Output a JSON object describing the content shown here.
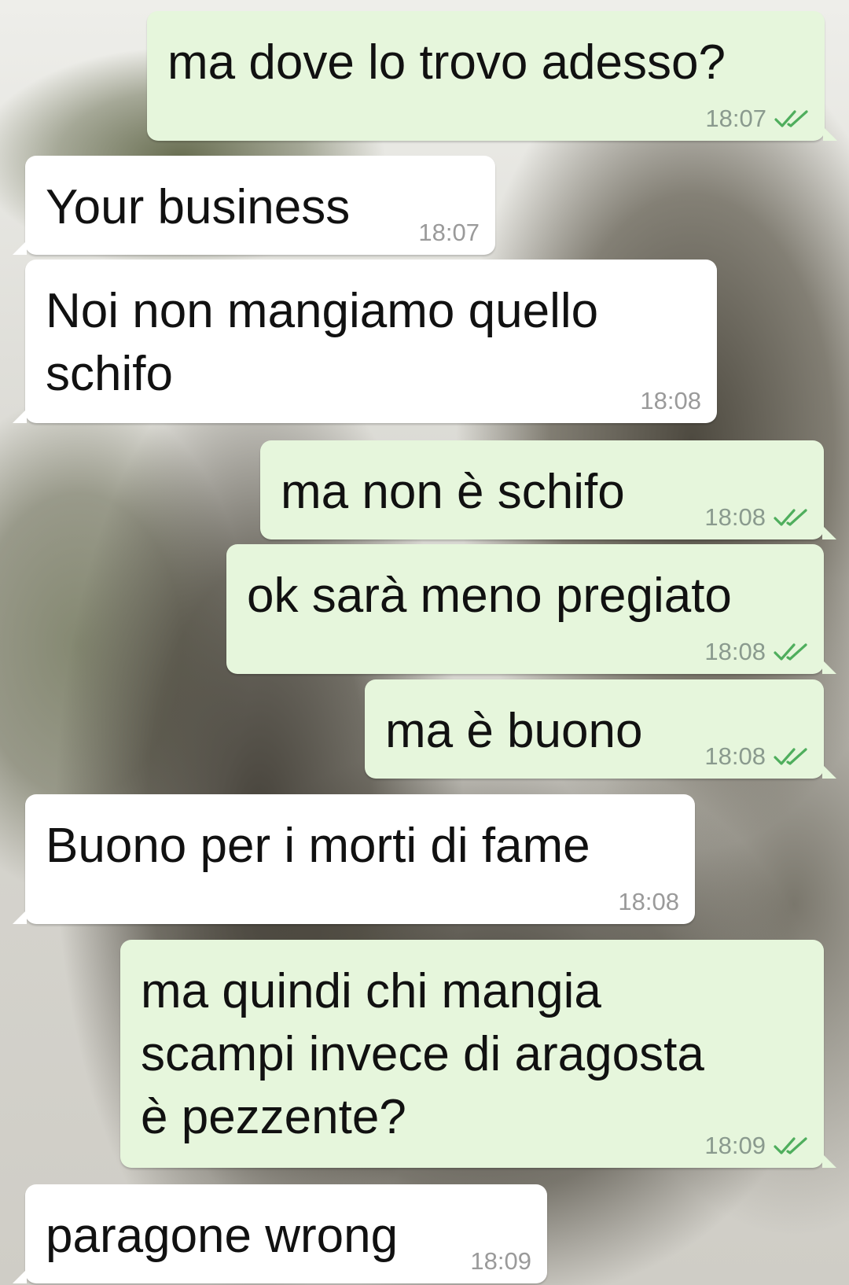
{
  "chat": {
    "messages": [
      {
        "direction": "outgoing",
        "text": "ma dove lo trovo adesso?",
        "time": "18:07",
        "status_icon": "double-check-icon"
      },
      {
        "direction": "incoming",
        "text": "Your business",
        "time": "18:07"
      },
      {
        "direction": "incoming",
        "text": "Noi non mangiamo quello\nschifo",
        "time": "18:08"
      },
      {
        "direction": "outgoing",
        "text": "ma non è schifo",
        "time": "18:08",
        "status_icon": "double-check-icon"
      },
      {
        "direction": "outgoing",
        "text": "ok sarà meno pregiato",
        "time": "18:08",
        "status_icon": "double-check-icon"
      },
      {
        "direction": "outgoing",
        "text": "ma è buono",
        "time": "18:08",
        "status_icon": "double-check-icon"
      },
      {
        "direction": "incoming",
        "text": "Buono per i morti di fame",
        "time": "18:08"
      },
      {
        "direction": "outgoing",
        "text": "ma quindi chi mangia\nscampi invece di aragosta\nè pezzente?",
        "time": "18:09",
        "status_icon": "double-check-icon"
      },
      {
        "direction": "incoming",
        "text": "paragone wrong",
        "time": "18:09"
      }
    ]
  },
  "colors": {
    "incoming_bubble": "#ffffff",
    "outgoing_bubble": "#e6f6dc",
    "read_check": "#4fae5d",
    "timestamp": "#9a9a9a"
  }
}
